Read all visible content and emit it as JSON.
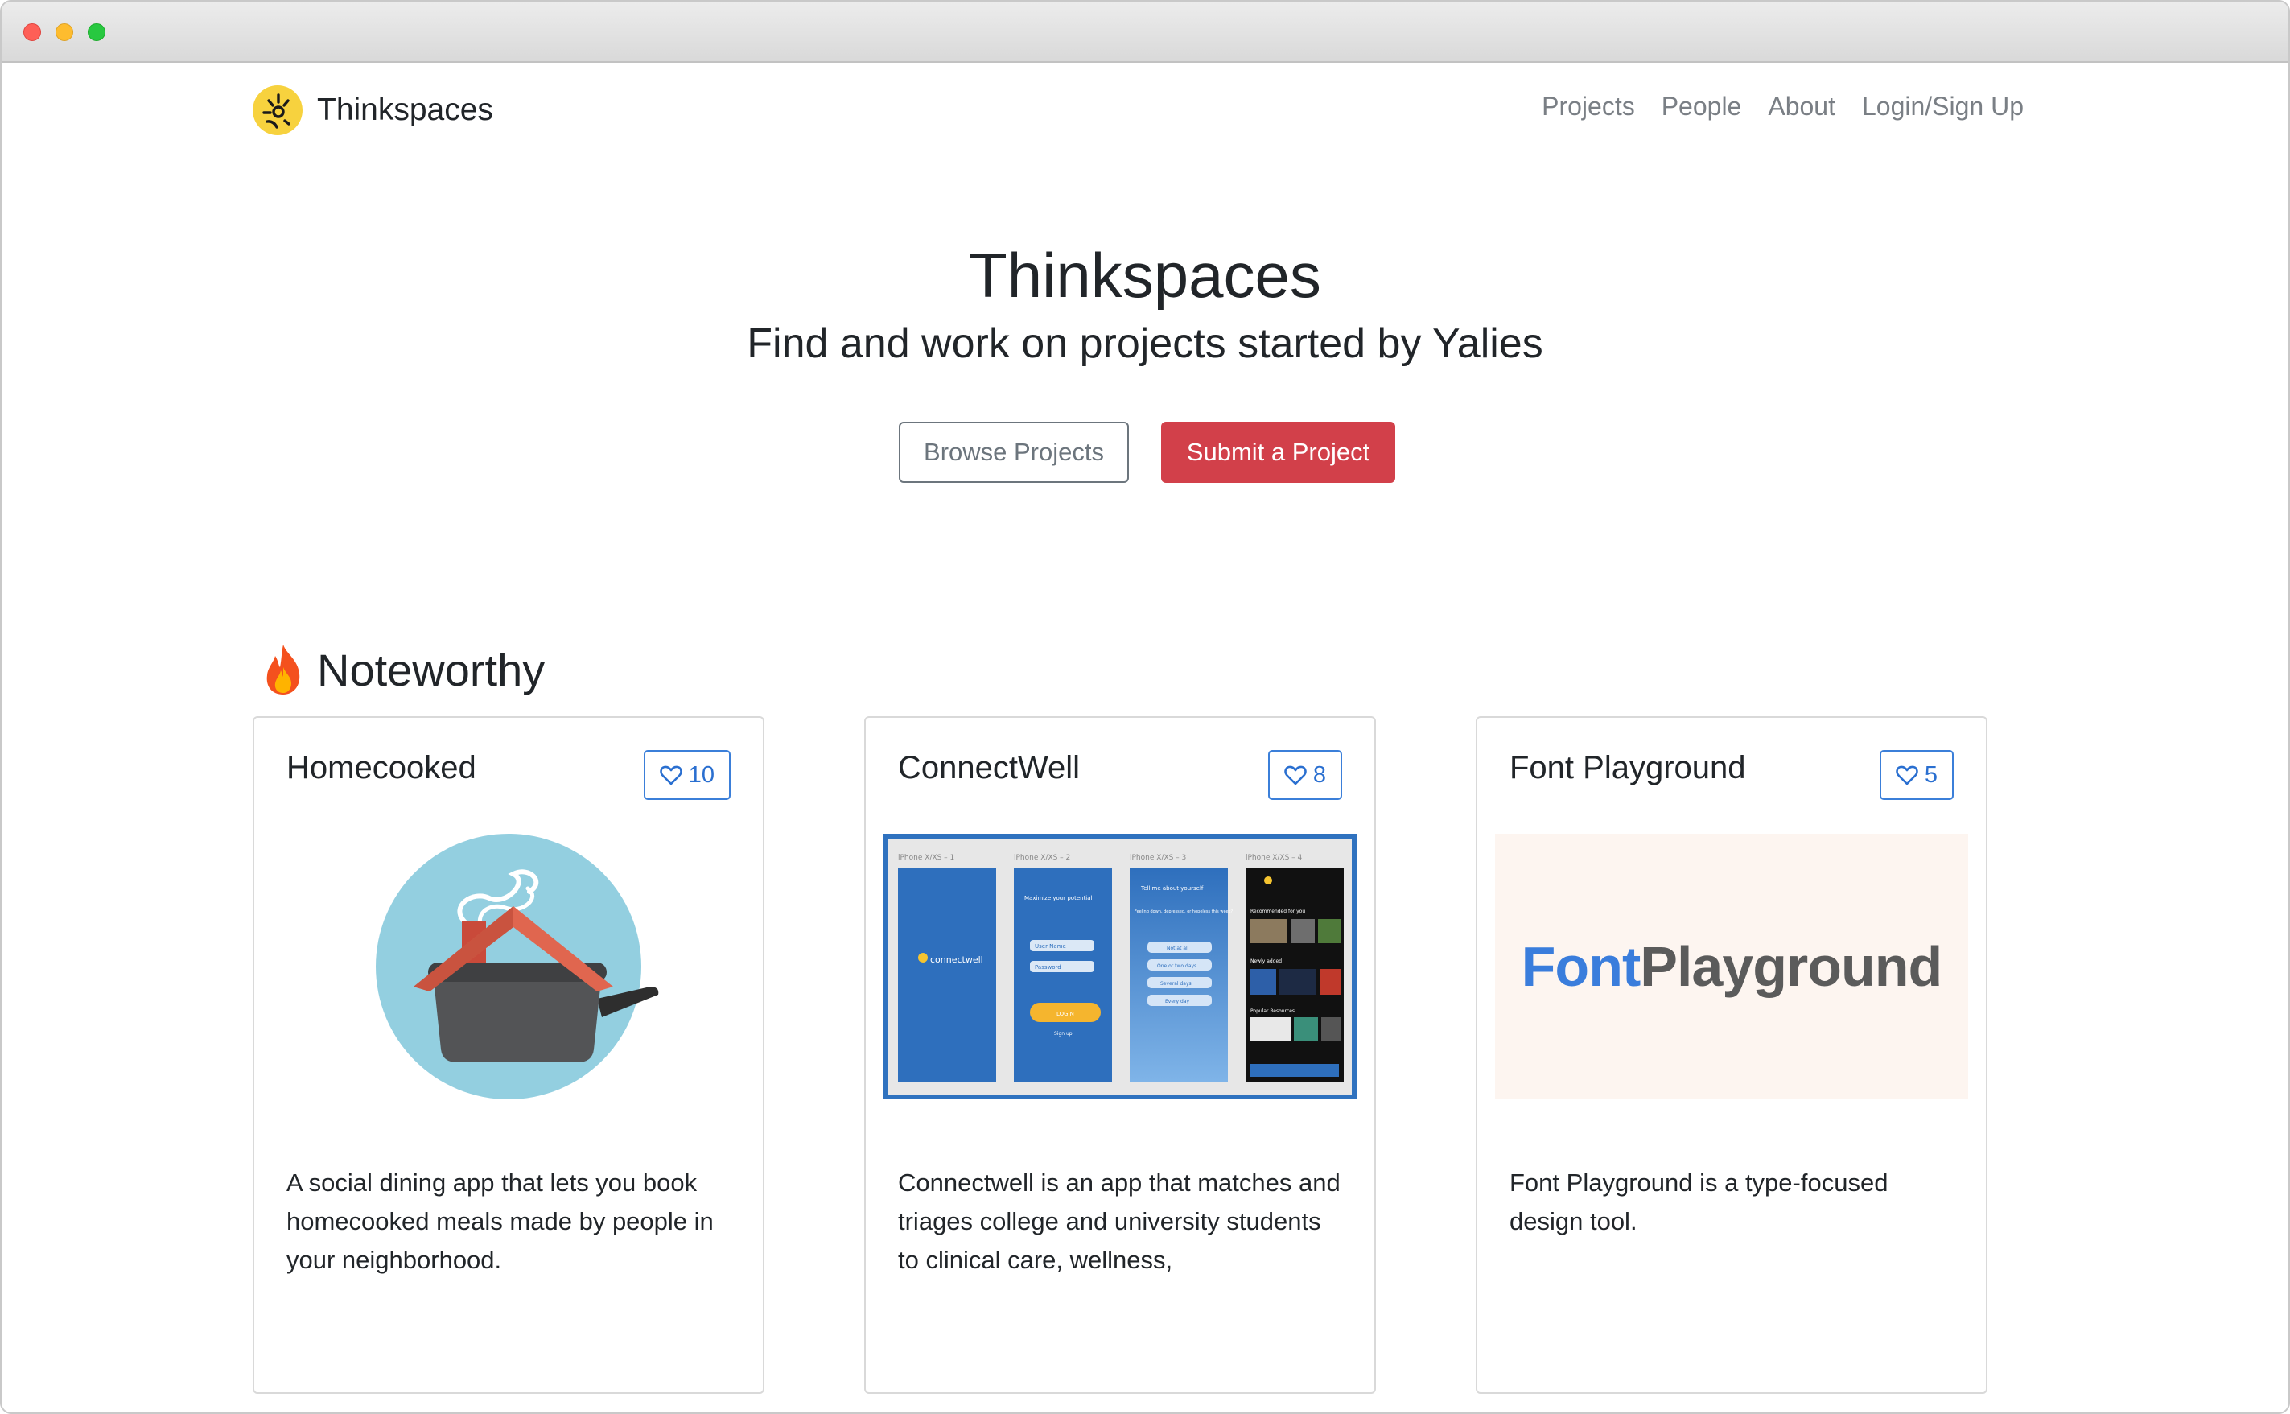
{
  "navbar": {
    "brand": "Thinkspaces",
    "links": [
      "Projects",
      "People",
      "About",
      "Login/Sign Up"
    ]
  },
  "hero": {
    "title": "Thinkspaces",
    "subtitle": "Find and work on projects started by Yalies",
    "browse_label": "Browse Projects",
    "submit_label": "Submit a Project"
  },
  "section": {
    "title": "Noteworthy"
  },
  "cards": [
    {
      "title": "Homecooked",
      "likes": "10",
      "description": "A social dining app that lets you book homecooked meals made by people in your neighborhood."
    },
    {
      "title": "ConnectWell",
      "likes": "8",
      "description": "Connectwell is an app that matches and triages college and university students to clinical care, wellness,"
    },
    {
      "title": "Font Playground",
      "likes": "5",
      "description": "Font Playground is a type-focused design tool.",
      "logo_part1": "Font",
      "logo_part2": "Playground"
    }
  ],
  "connectwell_screens": [
    {
      "label": "iPhone X/XS – 1",
      "brand": "connectwell"
    },
    {
      "label": "iPhone X/XS – 2",
      "heading": "Maximize your potential",
      "field1": "User Name",
      "field2": "Password",
      "login": "LOGIN",
      "signup": "Sign up"
    },
    {
      "label": "iPhone X/XS – 3",
      "heading": "Tell me about yourself",
      "question": "Feeling down, depressed, or hopeless this week?",
      "options": [
        "Not at all",
        "One or two days",
        "Several days",
        "Every day"
      ]
    },
    {
      "label": "iPhone X/XS – 4",
      "section1": "Recommended for you",
      "section2": "Newly added",
      "section3": "Popular Resources"
    }
  ],
  "colors": {
    "accent_red": "#d2404a",
    "accent_blue": "#3b7fd9",
    "muted": "#7a7f85"
  }
}
